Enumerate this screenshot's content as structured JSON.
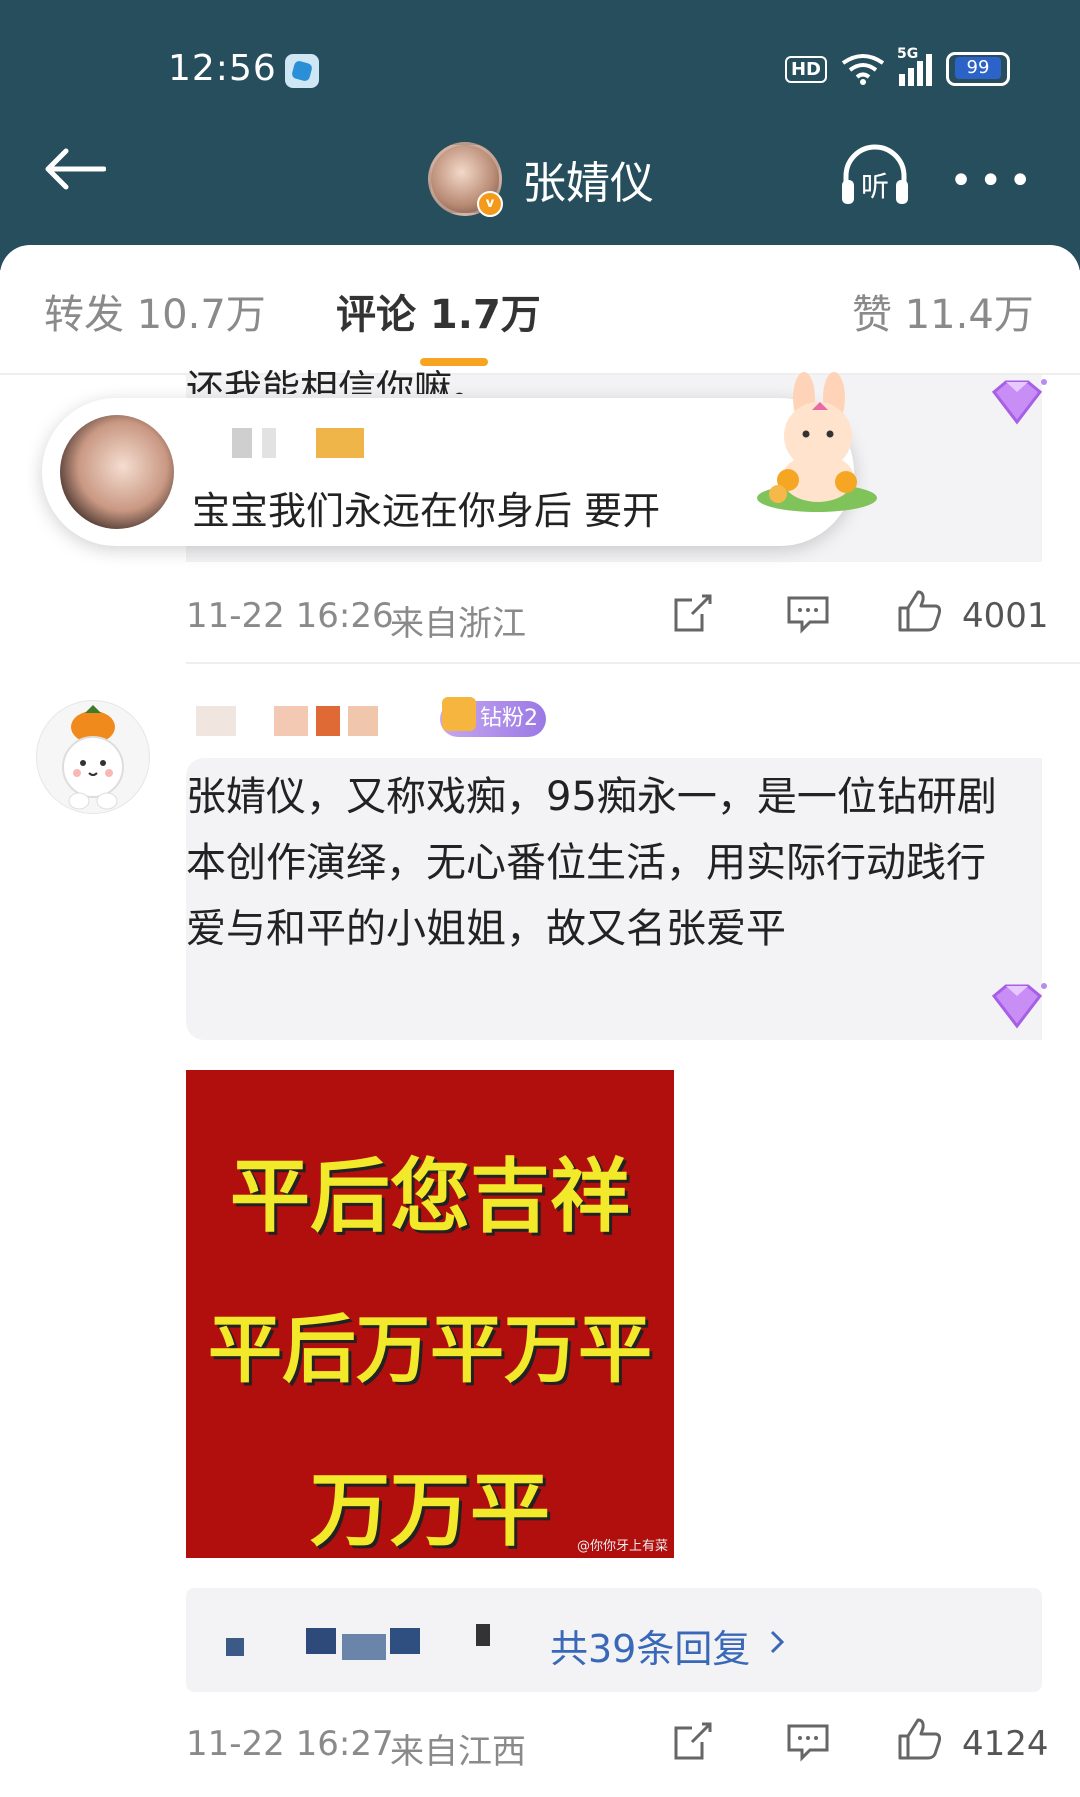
{
  "status_bar": {
    "time": "12:56",
    "hd": "HD",
    "network": "5G",
    "battery": "99"
  },
  "header": {
    "title": "张婧仪",
    "verified_badge": "v",
    "listen_label": "听"
  },
  "tabs": [
    {
      "label": "转发 10.7万"
    },
    {
      "label": "评论 1.7万"
    },
    {
      "label": "赞 11.4万"
    }
  ],
  "comment1": {
    "cut_text": "还我能相信你嘛。",
    "popup_text": "宝宝我们永远在你身后 要开",
    "timestamp": "11-22 16:26",
    "location": "来自浙江",
    "likes": "4001"
  },
  "comment2": {
    "fan_badge": "钻粉2",
    "text": "张婧仪，又称戏痴，95痴永一，是一位钻研剧本创作演绎，无心番位生活，用实际行动践行爱与和平的小姐姐，故又名张爱平",
    "image_lines": [
      "平后您吉祥",
      "平后万平万平",
      "万万平"
    ],
    "image_watermark": "@你你牙上有菜",
    "reply_link": "共39条回复",
    "timestamp": "11-22 16:27",
    "location": "来自江西",
    "likes": "4124"
  }
}
